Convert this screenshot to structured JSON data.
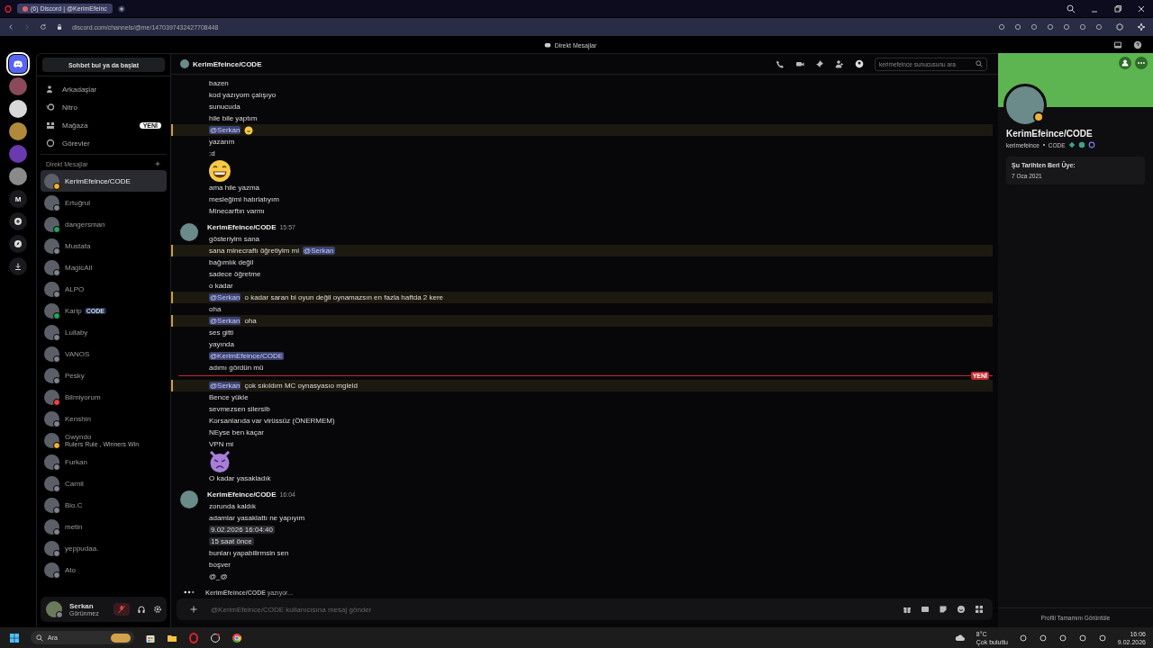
{
  "browser": {
    "tab_title": "(6) Discord | @KerimEfeinc",
    "url": "discord.com/channels/@me/1470397432427708448"
  },
  "app_title": "Direkt Mesajlar",
  "servers": [
    {
      "kind": "home",
      "selected": true
    },
    {
      "kind": "avatar",
      "color": "#8a4a5a",
      "selected": false
    },
    {
      "kind": "avatar",
      "color": "#d8d8d8",
      "selected": false
    },
    {
      "kind": "avatar",
      "color": "#b08a3a",
      "selected": false
    },
    {
      "kind": "avatar",
      "color": "#6a3ab0",
      "selected": false
    },
    {
      "kind": "avatar",
      "color": "#8a8a8a",
      "selected": false
    },
    {
      "kind": "letter",
      "label": "M",
      "selected": false
    },
    {
      "kind": "add",
      "selected": false
    },
    {
      "kind": "explore",
      "selected": false
    },
    {
      "kind": "download",
      "selected": false
    }
  ],
  "sidebar": {
    "search_button": "Sohbet bul ya da başlat",
    "nav": [
      {
        "kind": "friends",
        "label": "Arkadaşlar"
      },
      {
        "kind": "nitro",
        "label": "Nitro"
      },
      {
        "kind": "shop",
        "label": "Mağaza",
        "badge": "YENİ"
      },
      {
        "kind": "quests",
        "label": "Görevler"
      }
    ],
    "dm_header": "Direkt Mesajlar",
    "dms": [
      {
        "name": "KerimEfeince/CODE",
        "color": "#f0b232",
        "selected": true
      },
      {
        "name": "Ertuğrul",
        "color": "#80848e",
        "selected": false
      },
      {
        "name": "dangersman",
        "color": "#23a55a",
        "selected": false
      },
      {
        "name": "Mustafa",
        "color": "#80848e",
        "selected": false
      },
      {
        "name": "MagicAll",
        "color": "#80848e",
        "selected": false
      },
      {
        "name": "ALPO",
        "color": "#80848e",
        "selected": false
      },
      {
        "name": "Karip",
        "color": "#23a55a",
        "tag": "CODE",
        "selected": false
      },
      {
        "name": "Lullaby",
        "color": "#80848e",
        "selected": false
      },
      {
        "name": "VANOS",
        "color": "#80848e",
        "selected": false
      },
      {
        "name": "Pesky",
        "color": "#80848e",
        "selected": false
      },
      {
        "name": "Bilmiyorum",
        "color": "#f23f43",
        "selected": false
      },
      {
        "name": "Kenshin",
        "color": "#80848e",
        "selected": false
      },
      {
        "name": "Gwyndo",
        "color": "#f0b232",
        "subtitle": "Rulers Rule , Winners Win",
        "selected": false
      },
      {
        "name": "Furkan",
        "color": "#80848e",
        "selected": false
      },
      {
        "name": "Carnil",
        "color": "#80848e",
        "selected": false
      },
      {
        "name": "Bio.C",
        "color": "#80848e",
        "selected": false
      },
      {
        "name": "metin",
        "color": "#80848e",
        "selected": false
      },
      {
        "name": "yeppudaa.",
        "color": "#80848e",
        "selected": false
      },
      {
        "name": "Ato",
        "color": "#80848e",
        "selected": false
      }
    ]
  },
  "user_panel": {
    "name": "Serkan",
    "status": "Görünmez",
    "mic_muted": true
  },
  "chat": {
    "title": "KerimEfeince/CODE",
    "search_placeholder": "kerimefeince sunucusunu ara",
    "groups": [
      {
        "lines": [
          {
            "kind": "text",
            "highlighted": false,
            "parts": [
              {
                "kind": "text",
                "text": "bazen"
              }
            ]
          },
          {
            "kind": "text",
            "highlighted": false,
            "parts": [
              {
                "kind": "text",
                "text": "kod yazıyom çalışıyo"
              }
            ]
          },
          {
            "kind": "text",
            "highlighted": false,
            "parts": [
              {
                "kind": "text",
                "text": "sunucuda"
              }
            ]
          },
          {
            "kind": "text",
            "highlighted": false,
            "parts": [
              {
                "kind": "text",
                "text": "hile bile yaptım"
              }
            ]
          },
          {
            "kind": "text",
            "highlighted": true,
            "parts": [
              {
                "kind": "mention",
                "text": "@Serkan"
              },
              {
                "kind": "emoji"
              }
            ]
          },
          {
            "kind": "text",
            "highlighted": false,
            "parts": [
              {
                "kind": "text",
                "text": "yazarım"
              }
            ]
          },
          {
            "kind": "text",
            "highlighted": false,
            "parts": [
              {
                "kind": "text",
                "text": ":d"
              }
            ]
          },
          {
            "kind": "grin",
            "highlighted": false
          },
          {
            "kind": "text",
            "highlighted": false,
            "parts": [
              {
                "kind": "text",
                "text": "ama hile yazma"
              }
            ]
          },
          {
            "kind": "text",
            "highlighted": false,
            "parts": [
              {
                "kind": "text",
                "text": "mesleğimi hatırlatıyım"
              }
            ]
          },
          {
            "kind": "text",
            "highlighted": false,
            "parts": [
              {
                "kind": "text",
                "text": "Minecarftın varmı"
              }
            ]
          }
        ]
      },
      {
        "author": "KerimEfeince/CODE",
        "time": "15:57",
        "lines": [
          {
            "kind": "text",
            "highlighted": false,
            "parts": [
              {
                "kind": "text",
                "text": "gösteriyim sana"
              }
            ]
          },
          {
            "kind": "text",
            "highlighted": true,
            "parts": [
              {
                "kind": "text",
                "text": "sana minecraftı öğretiyim mi"
              },
              {
                "kind": "mention",
                "text": "@Serkan"
              }
            ]
          },
          {
            "kind": "text",
            "highlighted": false,
            "parts": [
              {
                "kind": "text",
                "text": "bağımlık değil"
              }
            ]
          },
          {
            "kind": "text",
            "highlighted": false,
            "parts": [
              {
                "kind": "text",
                "text": "sadece öğretme"
              }
            ]
          },
          {
            "kind": "text",
            "highlighted": false,
            "parts": [
              {
                "kind": "text",
                "text": "o kadar"
              }
            ]
          },
          {
            "kind": "text",
            "highlighted": true,
            "parts": [
              {
                "kind": "mention",
                "text": "@Serkan"
              },
              {
                "kind": "text",
                "text": "o kadar saran bi oyun değil oynamazsın en fazla haftda 2 kere"
              }
            ]
          },
          {
            "kind": "text",
            "highlighted": false,
            "parts": [
              {
                "kind": "text",
                "text": "oha"
              }
            ]
          },
          {
            "kind": "text",
            "highlighted": true,
            "parts": [
              {
                "kind": "mention",
                "text": "@Serkan"
              },
              {
                "kind": "text",
                "text": "oha"
              }
            ]
          },
          {
            "kind": "text",
            "highlighted": false,
            "parts": [
              {
                "kind": "text",
                "text": "ses gitti"
              }
            ]
          },
          {
            "kind": "text",
            "highlighted": false,
            "parts": [
              {
                "kind": "text",
                "text": "yayında"
              }
            ]
          },
          {
            "kind": "text",
            "highlighted": false,
            "parts": [
              {
                "kind": "mention",
                "text": "@KerimEfeince/CODE"
              }
            ]
          },
          {
            "kind": "text",
            "highlighted": false,
            "parts": [
              {
                "kind": "text",
                "text": "adımı gördün mü"
              }
            ]
          },
          {
            "kind": "divider",
            "highlighted": false,
            "label": "YENİ"
          },
          {
            "kind": "text",
            "highlighted": true,
            "parts": [
              {
                "kind": "mention",
                "text": "@Serkan"
              },
              {
                "kind": "text",
                "text": "çok sıkıldım MC  oynasyasıo mgleld"
              }
            ]
          },
          {
            "kind": "text",
            "highlighted": false,
            "parts": [
              {
                "kind": "text",
                "text": "Bence yükle"
              }
            ]
          },
          {
            "kind": "text",
            "highlighted": false,
            "parts": [
              {
                "kind": "text",
                "text": "sevmezsen silersib"
              }
            ]
          },
          {
            "kind": "text",
            "highlighted": false,
            "parts": [
              {
                "kind": "text",
                "text": "Korsanlarıda var virüssüz (ÖNERMEM)"
              }
            ]
          },
          {
            "kind": "text",
            "highlighted": false,
            "parts": [
              {
                "kind": "text",
                "text": "NEyse ben kaçar"
              }
            ]
          },
          {
            "kind": "text",
            "highlighted": false,
            "parts": [
              {
                "kind": "text",
                "text": "VPN mi"
              }
            ]
          },
          {
            "kind": "devil",
            "highlighted": false
          },
          {
            "kind": "text",
            "highlighted": false,
            "parts": [
              {
                "kind": "text",
                "text": "O kadar yasakladık"
              }
            ]
          }
        ]
      },
      {
        "author": "KerimEfeince/CODE",
        "time": "16:04",
        "lines": [
          {
            "kind": "text",
            "highlighted": false,
            "parts": [
              {
                "kind": "text",
                "text": "zorunda kaldık"
              }
            ]
          },
          {
            "kind": "text",
            "highlighted": false,
            "parts": [
              {
                "kind": "text",
                "text": "adamlar yasaklattı ne yapıyım"
              }
            ]
          },
          {
            "kind": "chip",
            "highlighted": false,
            "text": "9.02.2026 16:04:40"
          },
          {
            "kind": "chip",
            "highlighted": false,
            "text": "15 saat önce"
          },
          {
            "kind": "text",
            "highlighted": false,
            "parts": [
              {
                "kind": "text",
                "text": "bunları yapabilirmsin sen"
              }
            ]
          },
          {
            "kind": "text",
            "highlighted": false,
            "parts": [
              {
                "kind": "text",
                "text": "boşver"
              }
            ]
          },
          {
            "kind": "text",
            "highlighted": false,
            "parts": [
              {
                "kind": "text",
                "text": "@_@"
              }
            ]
          }
        ]
      }
    ],
    "typing": "**KerimEfeince/CODE** yazıyor...",
    "composer_placeholder": "@KerimEfeince/CODE kullanıcısına mesaj gönder"
  },
  "profile": {
    "name": "KerimEfeince/CODE",
    "username": "kerimefeince",
    "tag": "CODE",
    "member_since_label": "Şu Tarihten Beri Üye:",
    "member_since": "7 Oca 2021",
    "footer_button": "Profili Tamamını Görüntüle"
  },
  "taskbar": {
    "search": "Ara",
    "temperature": "8°C",
    "weather": "Çok bulutlu",
    "time": "16:06",
    "date": "9.02.2026"
  }
}
